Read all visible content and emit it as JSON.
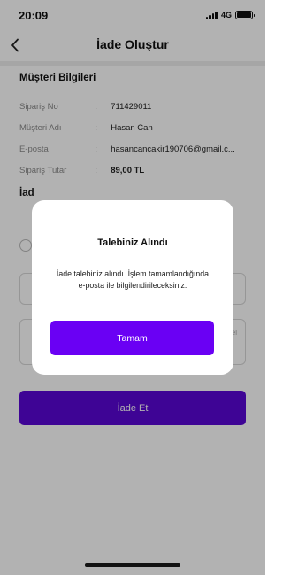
{
  "status_bar": {
    "time": "20:09",
    "network": "4G",
    "signal_bars": 4,
    "battery_level": 1.0
  },
  "nav": {
    "back_icon": "chevron-left-icon",
    "title": "İade Oluştur"
  },
  "customer_info": {
    "title": "Müşteri Bilgileri",
    "separator": ":",
    "rows": [
      {
        "label": "Sipariş No",
        "value": "711429011"
      },
      {
        "label": "Müşteri Adı",
        "value": "Hasan Can"
      },
      {
        "label": "E-posta",
        "value": "hasancancakir190706@gmail.c..."
      },
      {
        "label": "Sipariş Tutar",
        "value": "89,00 TL"
      }
    ]
  },
  "form": {
    "section_label_partial": "İad",
    "field2_hint_partial": "el",
    "submit_label": "İade Et"
  },
  "dialog": {
    "title": "Talebiniz Alındı",
    "message": "İade talebiniz alındı. İşlem tamamlandığında e-posta ile bilgilendirileceksiniz.",
    "button_label": "Tamam"
  },
  "colors": {
    "primary": "#6a00f4",
    "primary_dimmed": "#5a07d6",
    "overlay": "rgba(0,0,0,0.30)"
  }
}
